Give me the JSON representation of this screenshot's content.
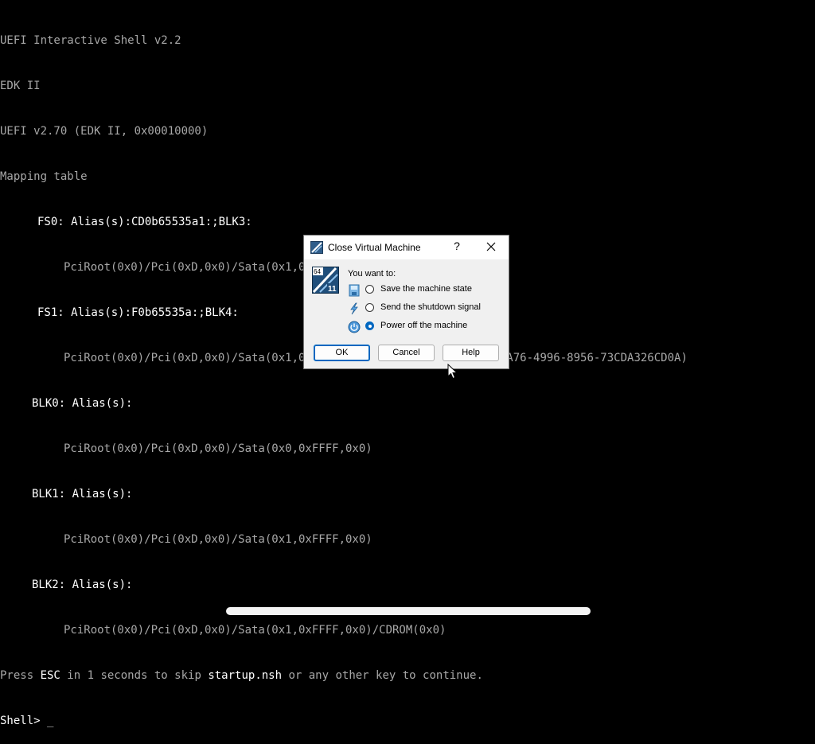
{
  "console": {
    "lines": [
      "UEFI Interactive Shell v2.2",
      "EDK II",
      "UEFI v2.70 (EDK II, 0x00010000)",
      "Mapping table",
      "FS0: Alias(s):CD0b65535a1:;BLK3:",
      "PciRoot(0x0)/Pci(0xD,0x0)/Sata(0x1,0xFFFF,0x0)/CDROM(0x1)",
      "FS1: Alias(s):F0b65535a:;BLK4:",
      "PciRoot(0x0)/Pci(0xD,0x0)/Sata(0x1,0xFFFF,0x0)/VenMedia(C5BD4D42-1A76-4996-8956-73CDA326CD0A)",
      "BLK0: Alias(s):",
      "PciRoot(0x0)/Pci(0xD,0x0)/Sata(0x0,0xFFFF,0x0)",
      "BLK1: Alias(s):",
      "PciRoot(0x0)/Pci(0xD,0x0)/Sata(0x1,0xFFFF,0x0)",
      "BLK2: Alias(s):",
      "PciRoot(0x0)/Pci(0xD,0x0)/Sata(0x1,0xFFFF,0x0)/CDROM(0x0)"
    ],
    "escape": {
      "pre": "Press ",
      "esc": "ESC",
      "mid": " in 1 seconds to skip ",
      "file": "startup.nsh",
      "post": " or any other key to continue."
    },
    "prompt": "Shell> ",
    "cursor": "_"
  },
  "dialog": {
    "title": "Close Virtual Machine",
    "help_glyph": "?",
    "close_glyph": "✕",
    "prompt": "You want to:",
    "options": [
      {
        "label": "Save the machine state",
        "icon": "save-state-icon",
        "checked": false
      },
      {
        "label": "Send the shutdown signal",
        "icon": "shutdown-signal-icon",
        "checked": false
      },
      {
        "label": "Power off the machine",
        "icon": "power-off-icon",
        "checked": true
      }
    ],
    "buttons": {
      "ok": "OK",
      "cancel": "Cancel",
      "help": "Help"
    },
    "os_badge": {
      "bits": "64",
      "version": "11"
    }
  },
  "colors": {
    "console_text": "#a8a8a8",
    "console_highlight": "#ffffff",
    "accent": "#0067c0"
  }
}
